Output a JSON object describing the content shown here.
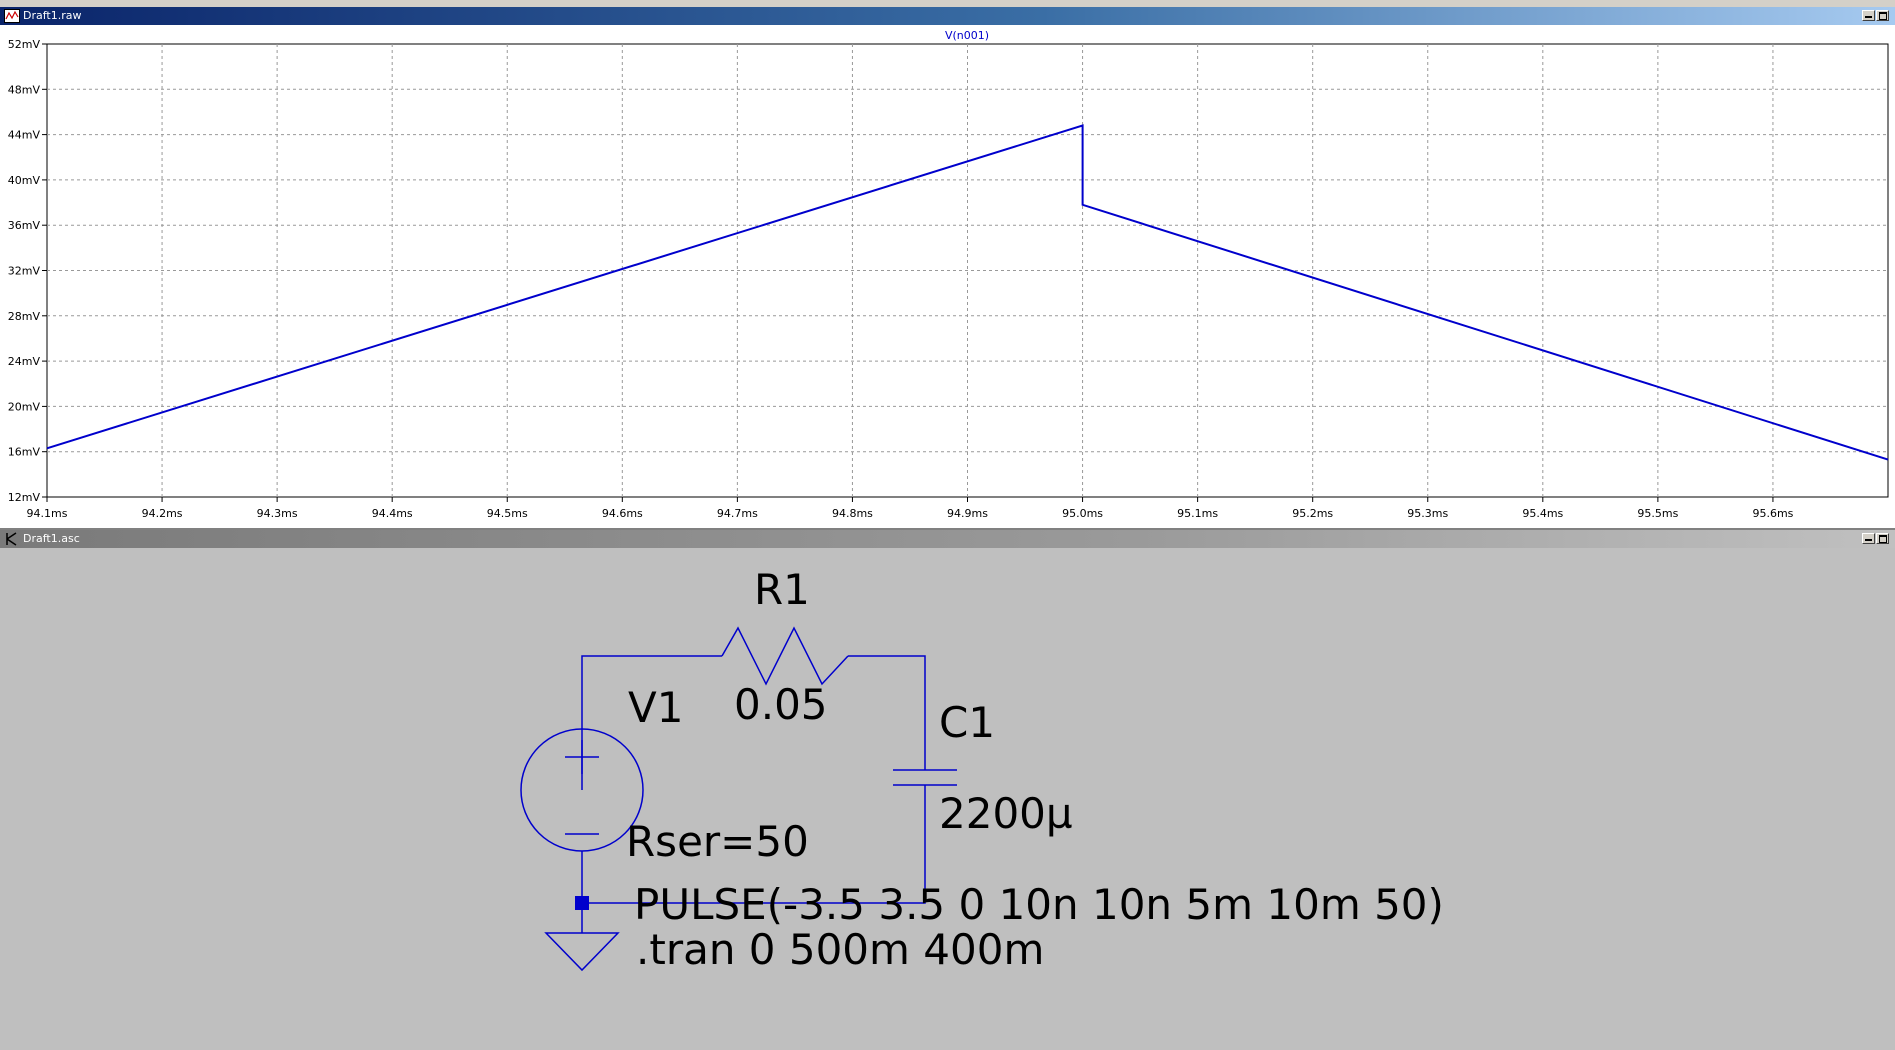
{
  "waveform_window": {
    "title": "Draft1.raw"
  },
  "schematic_window": {
    "title": "Draft1.asc"
  },
  "chart_data": {
    "type": "line",
    "x_unit": "ms",
    "y_unit": "mV",
    "xlim": [
      94.1,
      95.7
    ],
    "ylim": [
      12,
      52
    ],
    "x_ticks": [
      94.1,
      94.2,
      94.3,
      94.4,
      94.5,
      94.6,
      94.7,
      94.8,
      94.9,
      95.0,
      95.1,
      95.2,
      95.3,
      95.4,
      95.5,
      95.6
    ],
    "x_tick_labels": [
      "94.1ms",
      "94.2ms",
      "94.3ms",
      "94.4ms",
      "94.5ms",
      "94.6ms",
      "94.7ms",
      "94.8ms",
      "94.9ms",
      "95.0ms",
      "95.1ms",
      "95.2ms",
      "95.3ms",
      "95.4ms",
      "95.5ms",
      "95.6ms"
    ],
    "y_ticks": [
      12,
      16,
      20,
      24,
      28,
      32,
      36,
      40,
      44,
      48,
      52
    ],
    "y_tick_labels": [
      "12mV",
      "16mV",
      "20mV",
      "24mV",
      "28mV",
      "32mV",
      "36mV",
      "40mV",
      "44mV",
      "48mV",
      "52mV"
    ],
    "grid": true,
    "series": [
      {
        "name": "V(n001)",
        "color": "#0000cc",
        "x": [
          94.1,
          95.0,
          95.0,
          95.7
        ],
        "y": [
          16.3,
          44.8,
          37.8,
          15.3
        ]
      }
    ]
  },
  "schematic": {
    "wire_color": "#0000cc",
    "resistor": {
      "ref": "R1",
      "value": "0.05"
    },
    "capacitor": {
      "ref": "C1",
      "value": "2200µ"
    },
    "source": {
      "ref": "V1",
      "rser": "Rser=50",
      "pulse": "PULSE(-3.5 3.5 0 10n 10n 5m 10m 50)"
    },
    "directive": ".tran 0 500m 400m"
  }
}
